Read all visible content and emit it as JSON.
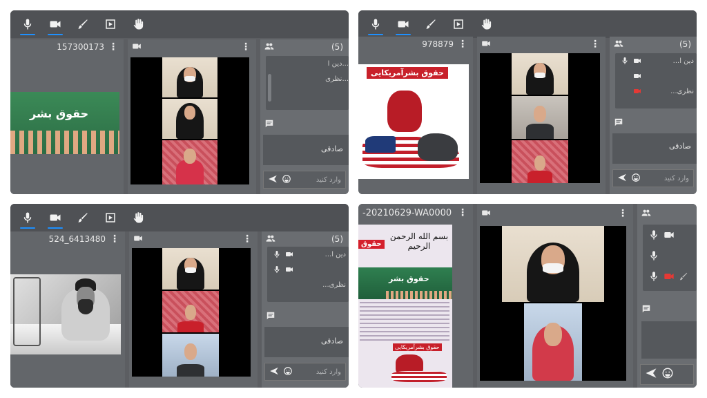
{
  "panels": [
    {
      "presentation_title": "157300173",
      "participant_count": "(5)",
      "users": [
        "...دین ا",
        "...نظری"
      ],
      "chat_message": "صادقی",
      "chat_placeholder": "وارد کنید",
      "poster_text": "حقوق بشر"
    },
    {
      "presentation_title": "978879",
      "participant_count": "(5)",
      "users": [
        "...دین ا",
        "",
        "...نظری"
      ],
      "chat_message": "صادقی",
      "chat_placeholder": "وارد کنید",
      "poster_text": "حقوق بشرآمریکایی"
    },
    {
      "presentation_title": "524_6413480",
      "participant_count": "(5)",
      "users": [
        "...دین ا",
        "",
        "...نظری"
      ],
      "chat_message": "صادقی",
      "chat_placeholder": "وارد کنید"
    },
    {
      "presentation_title": "-20210629-WA0000",
      "poster_header": "بسم الله الرحمن الرحیم",
      "poster_tag": "حقوق",
      "poster_text": "حقوق بشر",
      "poster_sub": "حقوق بشرآمریکایی"
    }
  ],
  "icons": [
    "mic-icon",
    "video-icon",
    "brush-icon",
    "play-icon",
    "hand-icon",
    "users-icon",
    "chat-icon",
    "send-icon",
    "emoji-icon"
  ],
  "colors": {
    "accent": "#1e90ff",
    "cam_off": "#e53935"
  }
}
